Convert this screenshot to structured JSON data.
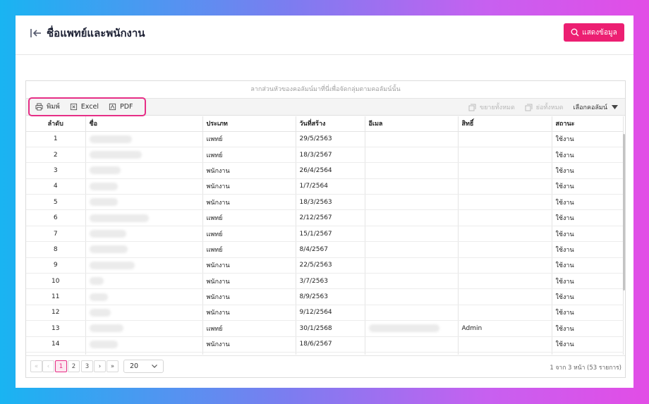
{
  "header": {
    "title": "ชื่อแพทย์และพนักงาน",
    "show_data_button": "แสดงข้อมูล"
  },
  "grid": {
    "group_panel_text": "ลากส่วนหัวของคอลัมน์มาที่นี่เพื่อจัดกลุ่มตามคอลัมน์นั้น",
    "toolbar": {
      "print": "พิมพ์",
      "excel": "Excel",
      "pdf": "PDF",
      "expand_all": "ขยายทั้งหมด",
      "collapse_all": "ย่อทั้งหมด",
      "column_chooser": "เลือกคอลัมน์"
    },
    "columns": [
      "ลำดับ",
      "ชื่อ",
      "ประเภท",
      "วันที่สร้าง",
      "อีเมล",
      "สิทธิ์",
      "สถานะ"
    ],
    "rows": [
      {
        "idx": "1",
        "type": "แพทย์",
        "created": "29/5/2563",
        "email": "",
        "role": "",
        "status": "ใช้งาน"
      },
      {
        "idx": "2",
        "type": "แพทย์",
        "created": "18/3/2567",
        "email": "",
        "role": "",
        "status": "ใช้งาน"
      },
      {
        "idx": "3",
        "type": "พนักงาน",
        "created": "26/4/2564",
        "email": "",
        "role": "",
        "status": "ใช้งาน"
      },
      {
        "idx": "4",
        "type": "พนักงาน",
        "created": "1/7/2564",
        "email": "",
        "role": "",
        "status": "ใช้งาน"
      },
      {
        "idx": "5",
        "type": "พนักงาน",
        "created": "18/3/2563",
        "email": "",
        "role": "",
        "status": "ใช้งาน"
      },
      {
        "idx": "6",
        "type": "แพทย์",
        "created": "2/12/2567",
        "email": "",
        "role": "",
        "status": "ใช้งาน"
      },
      {
        "idx": "7",
        "type": "แพทย์",
        "created": "15/1/2567",
        "email": "",
        "role": "",
        "status": "ใช้งาน"
      },
      {
        "idx": "8",
        "type": "แพทย์",
        "created": "8/4/2567",
        "email": "",
        "role": "",
        "status": "ใช้งาน"
      },
      {
        "idx": "9",
        "type": "พนักงาน",
        "created": "22/5/2563",
        "email": "",
        "role": "",
        "status": "ใช้งาน"
      },
      {
        "idx": "10",
        "type": "พนักงาน",
        "created": "3/7/2563",
        "email": "",
        "role": "",
        "status": "ใช้งาน"
      },
      {
        "idx": "11",
        "type": "พนักงาน",
        "created": "8/9/2563",
        "email": "",
        "role": "",
        "status": "ใช้งาน"
      },
      {
        "idx": "12",
        "type": "พนักงาน",
        "created": "9/12/2564",
        "email": "",
        "role": "",
        "status": "ใช้งาน"
      },
      {
        "idx": "13",
        "type": "แพทย์",
        "created": "30/1/2568",
        "email": "",
        "role": "Admin",
        "status": "ใช้งาน"
      },
      {
        "idx": "14",
        "type": "พนักงาน",
        "created": "18/6/2567",
        "email": "",
        "role": "",
        "status": "ใช้งาน"
      },
      {
        "idx": "",
        "type": "",
        "created": "",
        "email": "",
        "role": "",
        "status": ""
      }
    ]
  },
  "pager": {
    "first": "«",
    "prev": "‹",
    "pages": [
      "1",
      "2",
      "3"
    ],
    "current_page": "1",
    "next": "›",
    "last": "»",
    "page_size": "20",
    "info": "1 จาก 3 หน้า (53 รายการ)"
  },
  "colors": {
    "accent": "#ec1f72",
    "highlight_border": "#e62e86"
  }
}
